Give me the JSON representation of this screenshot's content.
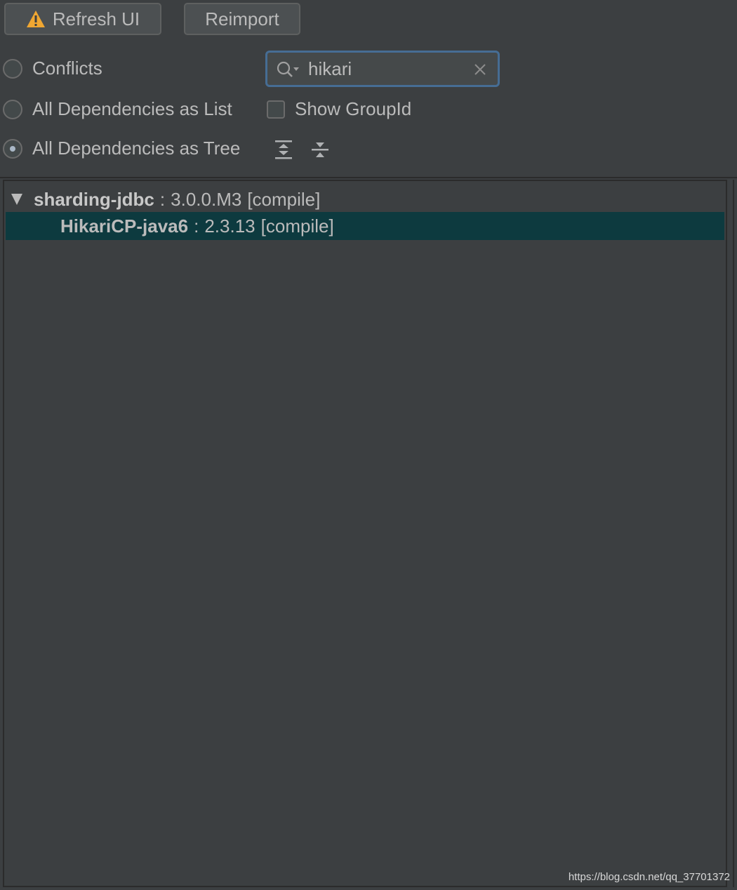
{
  "toolbar": {
    "refresh_label": "Refresh UI",
    "reimport_label": "Reimport"
  },
  "view_options": {
    "conflicts_label": "Conflicts",
    "list_label": "All Dependencies as List",
    "tree_label": "All Dependencies as Tree",
    "selected": "All Dependencies as Tree"
  },
  "search": {
    "value": "hikari",
    "placeholder": ""
  },
  "show_groupid": {
    "label": "Show GroupId",
    "checked": false
  },
  "icons": {
    "refresh": "warning-icon",
    "search": "search-icon",
    "clear": "close-icon",
    "expand": "expand-all-icon",
    "collapse": "collapse-all-icon",
    "tree_toggle": "triangle-down-icon"
  },
  "colors": {
    "background": "#3c3f41",
    "selection": "#0d3a3f",
    "warning": "#f0a732",
    "focus_border": "#466d94"
  },
  "tree": {
    "root": {
      "artifact": "sharding-jdbc",
      "separator": ":",
      "version": "3.0.0.M3",
      "scope": "[compile]"
    },
    "child": {
      "artifact": "HikariCP-java6",
      "separator": ":",
      "version": "2.3.13",
      "scope": "[compile]"
    }
  },
  "watermark": "https://blog.csdn.net/qq_37701372"
}
